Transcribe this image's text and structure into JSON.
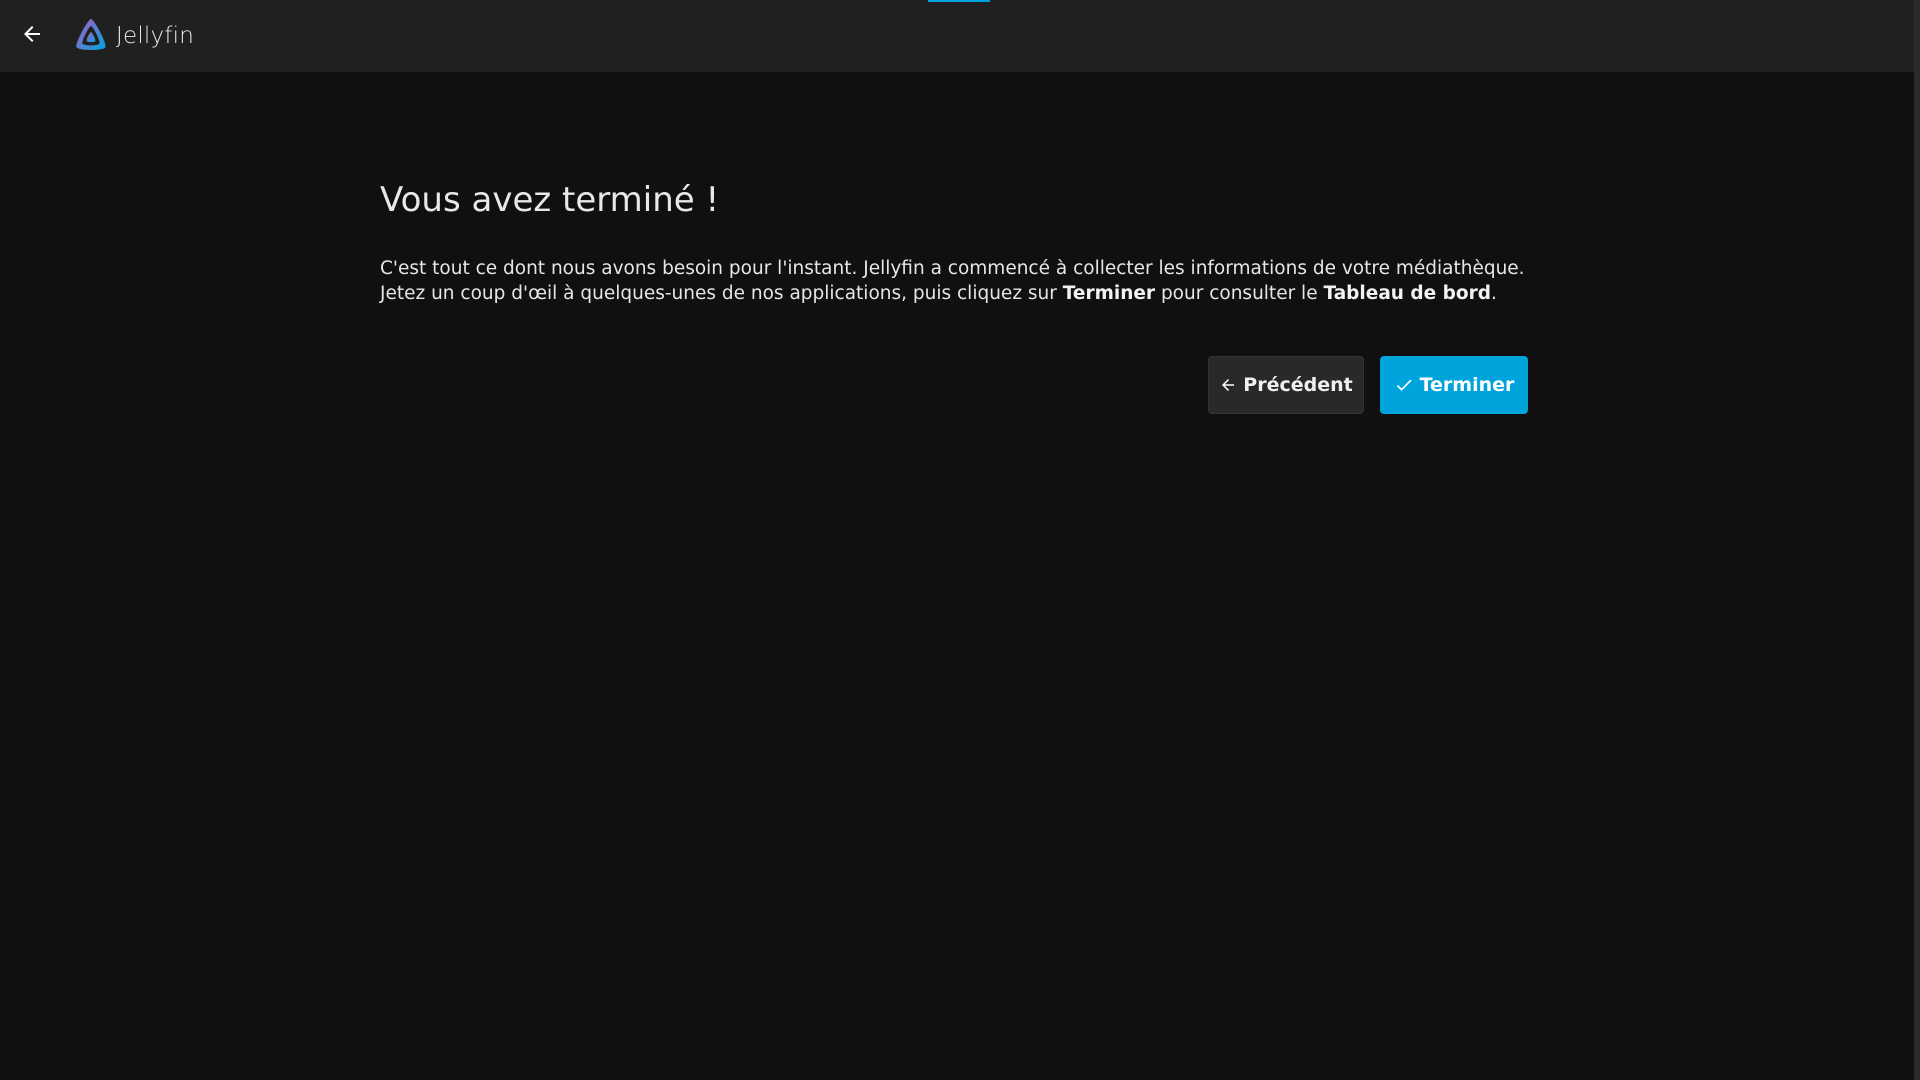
{
  "header": {
    "app_name": "Jellyfin",
    "back_icon": "arrow-left-icon",
    "logo_icon": "jellyfin-logo-icon",
    "accent_color": "#00a4dc"
  },
  "main": {
    "title": "Vous avez terminé !",
    "text_part1": "C'est tout ce dont nous avons besoin pour l'instant. Jellyfin a commencé à collecter les informations de votre médiathèque. Jetez un coup d'œil à quelques-unes de nos applications, puis cliquez sur ",
    "text_bold1": "Terminer",
    "text_part2": " pour consulter le ",
    "text_bold2": "Tableau de bord",
    "text_part3": "."
  },
  "buttons": {
    "previous_label": "Précédent",
    "previous_icon": "arrow-left-icon",
    "finish_label": "Terminer",
    "finish_icon": "check-icon",
    "finish_color": "#00a4dc"
  }
}
